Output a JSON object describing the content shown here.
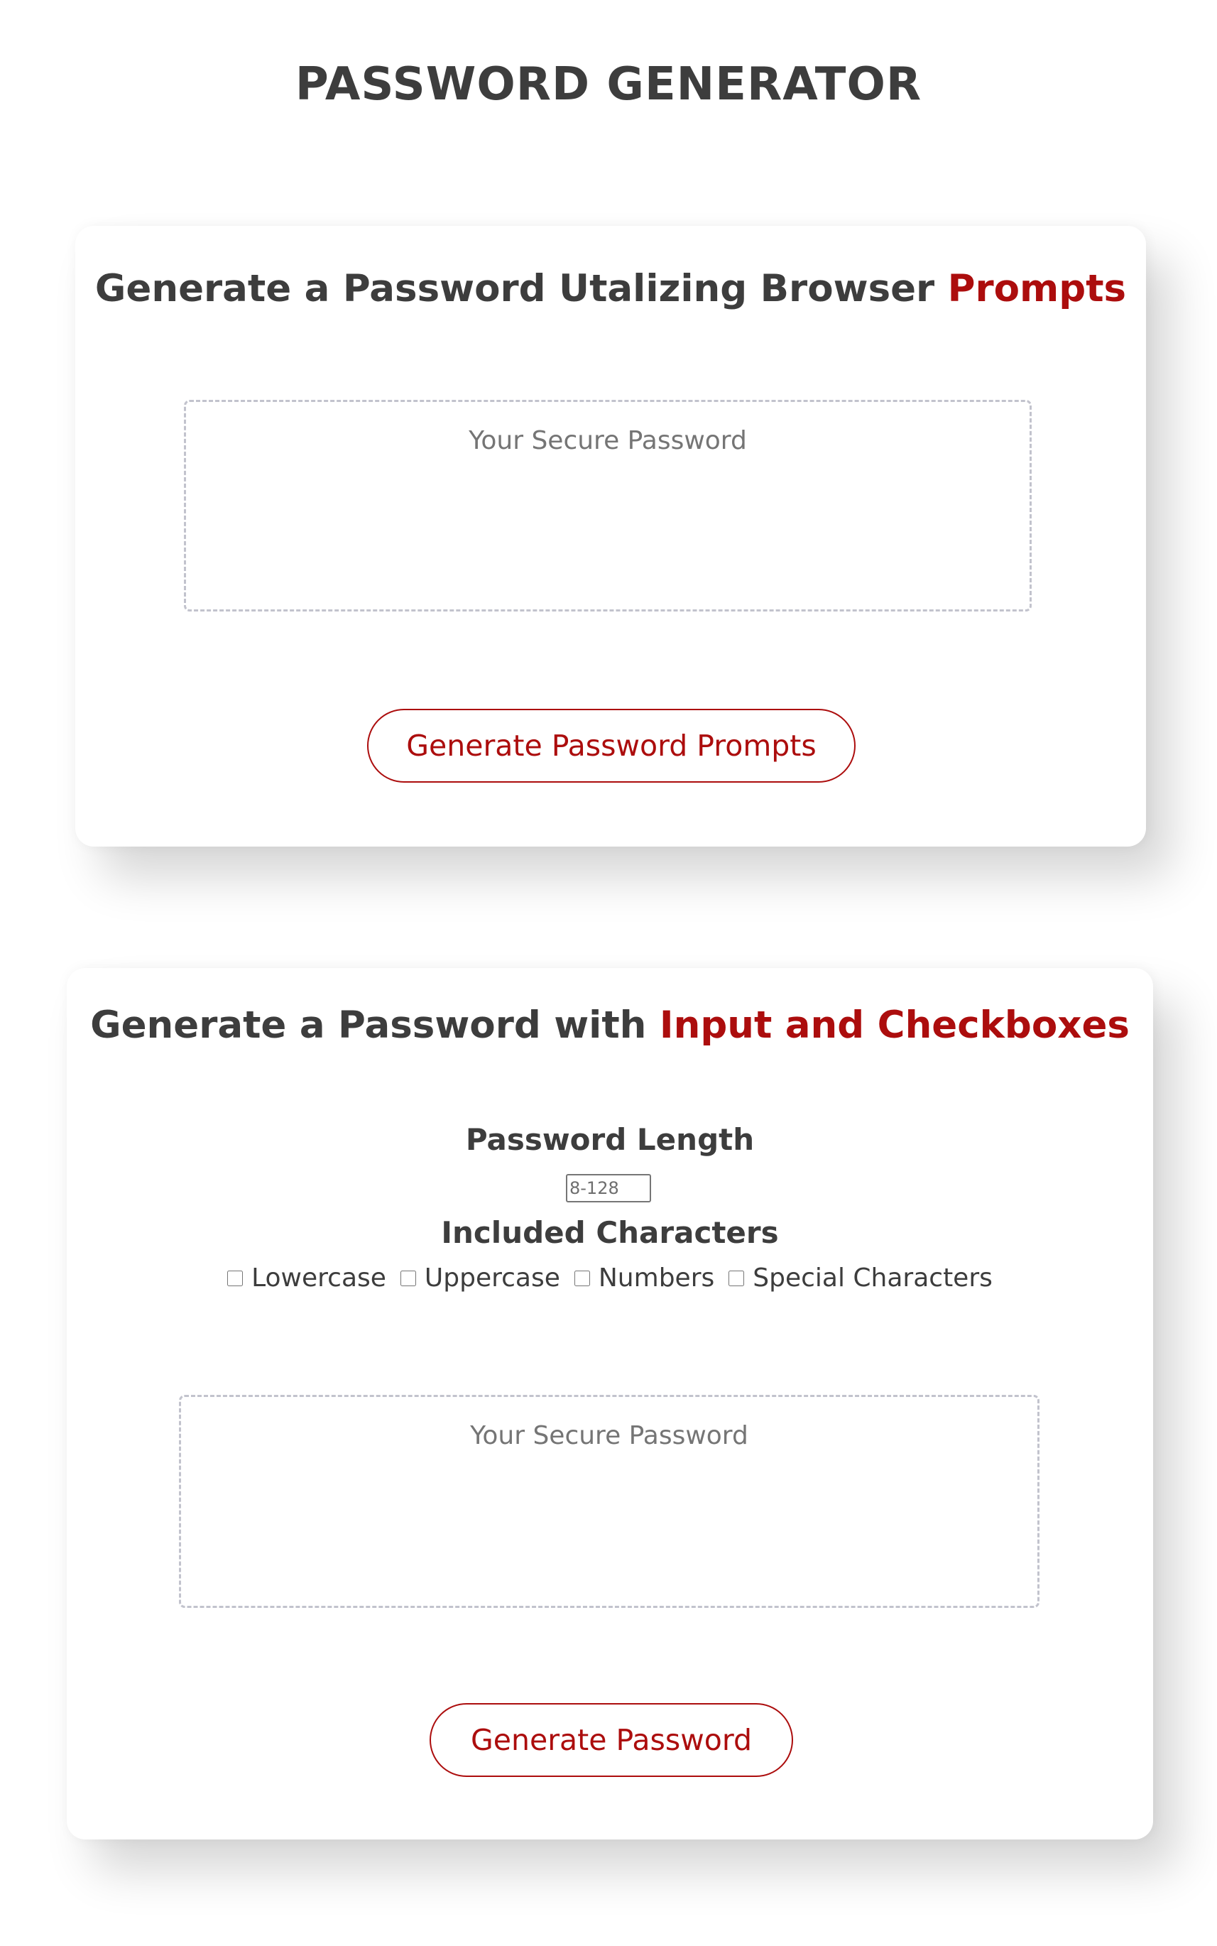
{
  "page": {
    "title": "PASSWORD GENERATOR"
  },
  "prompts_card": {
    "heading": "Generate a Password Utalizing Browser",
    "heading_accent": "Prompts",
    "password_placeholder": "Your Secure Password",
    "button_label": "Generate Password Prompts"
  },
  "checkbox_card": {
    "heading": "Generate a Password with",
    "heading_accent": "Input and Checkboxes",
    "length_label": "Password Length",
    "length_placeholder": "8-128",
    "characters_label": "Included Characters",
    "options": [
      {
        "label": "Lowercase",
        "checked": false
      },
      {
        "label": "Uppercase",
        "checked": false
      },
      {
        "label": "Numbers",
        "checked": false
      },
      {
        "label": "Special Characters",
        "checked": false
      }
    ],
    "password_placeholder": "Your Secure Password",
    "button_label": "Generate Password"
  },
  "colors": {
    "accent": "#ac0d0d",
    "text": "#3d3d3d",
    "placeholder": "#757575",
    "dashed_border": "#c2c3cd"
  }
}
